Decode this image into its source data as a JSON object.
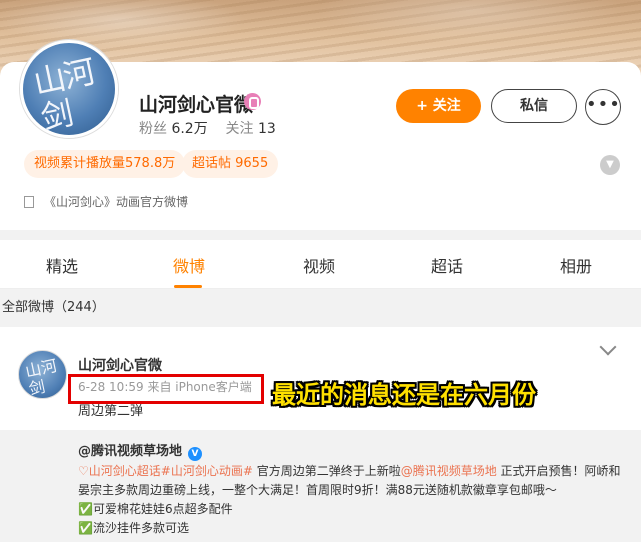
{
  "profile": {
    "avatar_text": "山河剑",
    "name": "山河剑心官微",
    "fans_label": "粉丝",
    "fans_value": "6.2万",
    "following_label": "关注",
    "following_value": "13",
    "follow_button": "+ 关注",
    "message_button": "私信",
    "more_button": "•••",
    "tags": [
      "视频累计播放量578.8万",
      "超话帖 9655"
    ],
    "description": "《山河剑心》动画官方微博"
  },
  "tabs": [
    "精选",
    "微博",
    "视频",
    "超话",
    "相册"
  ],
  "active_tab": "微博",
  "weibo_count": "全部微博（244）",
  "post": {
    "avatar_text": "山河剑",
    "author": "山河剑心官微",
    "meta": "6-28 10:59  来自 iPhone客户端",
    "text": "周边第二弹",
    "annotation": "最近的消息还是在六月份",
    "repost": {
      "author": "@腾讯视频草场地",
      "line1_prefix": "♡",
      "line1_links": "山河剑心超话#山河剑心动画#",
      "line1_mid": " 官方周边第二弹终于上新啦",
      "line1_mention": "@腾讯视频草场地",
      "line1_suffix": " 正式开启预售！阿峤和",
      "line2": "晏宗主多款周边重磅上线，一整个大满足！首周限时9折！满88元送随机款徽章享包邮哦～",
      "line3": "✅可爱棉花娃娃6点超多配件",
      "line4": "✅流沙挂件多款可选"
    }
  },
  "colors": {
    "accent": "#ff8200",
    "tag_text": "#ff6a00",
    "highlight_border": "#e30000",
    "annotation": "#ffe000"
  }
}
